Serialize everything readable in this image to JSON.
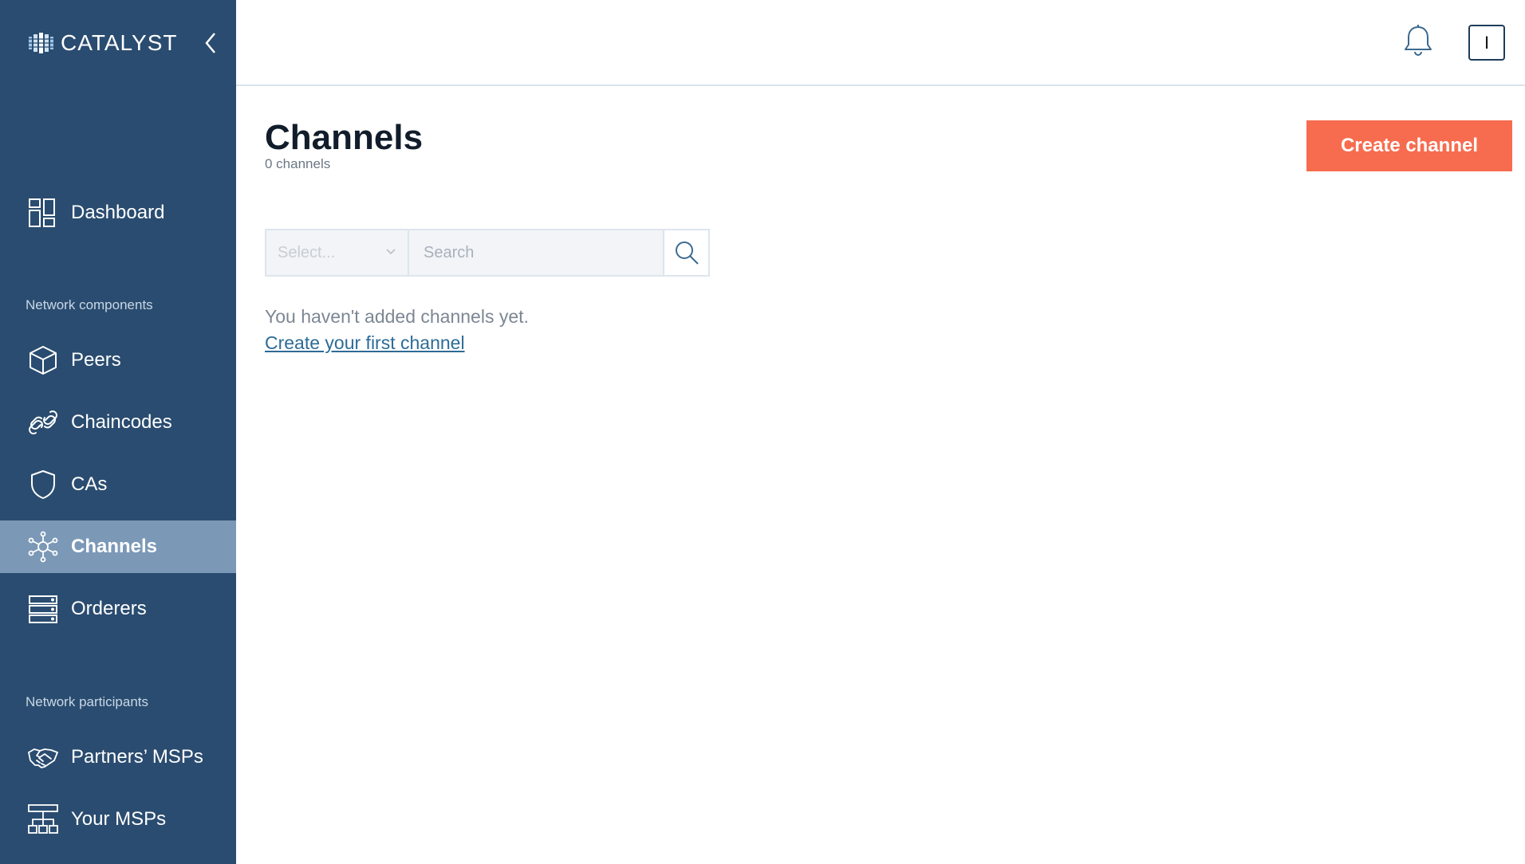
{
  "brand": {
    "name": "CATALYST",
    "icon": "catalyst-logo-icon"
  },
  "sidebar": {
    "collapse_icon": "chevron-left-icon",
    "dashboard": {
      "label": "Dashboard",
      "icon": "dashboard-icon"
    },
    "sections": [
      {
        "title": "Network components",
        "items": [
          {
            "label": "Peers",
            "icon": "cube-icon"
          },
          {
            "label": "Chaincodes",
            "icon": "link-icon"
          },
          {
            "label": "CAs",
            "icon": "shield-icon"
          },
          {
            "label": "Channels",
            "icon": "network-icon",
            "active": true
          },
          {
            "label": "Orderers",
            "icon": "server-icon"
          }
        ]
      },
      {
        "title": "Network participants",
        "items": [
          {
            "label": "Partners’ MSPs",
            "icon": "handshake-icon"
          },
          {
            "label": "Your MSPs",
            "icon": "org-chart-icon"
          }
        ]
      }
    ]
  },
  "topbar": {
    "bell_icon": "bell-icon",
    "avatar_initial": "I"
  },
  "main": {
    "title": "Channels",
    "subtitle": "0 channels",
    "create_button": "Create channel",
    "filter": {
      "select_placeholder": "Select...",
      "search_placeholder": "Search",
      "search_icon": "search-icon"
    },
    "empty_message": "You haven't added channels yet.",
    "empty_link": "Create your first channel"
  },
  "colors": {
    "sidebar_bg": "#2a4c70",
    "sidebar_active": "#7b98b7",
    "accent_button": "#f76c4f",
    "link": "#2d6b96"
  }
}
